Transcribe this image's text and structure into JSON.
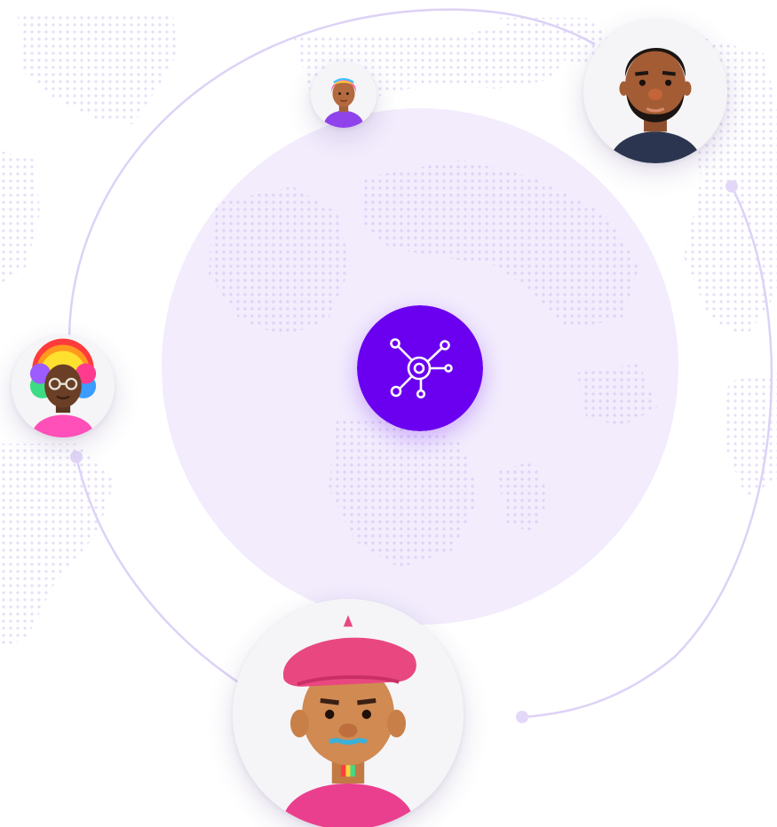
{
  "colors": {
    "accent": "#6b00f0",
    "central_disc": "#f2ecfd",
    "orbit_line": "#ddd2f6",
    "world_map_dots": "#e6def8"
  },
  "hub": {
    "icon": "network-hub-icon"
  },
  "avatars": [
    {
      "name": "avatar-woman-rainbow-hair-small",
      "icon": "person-avatar-icon"
    },
    {
      "name": "avatar-man-beard",
      "icon": "person-avatar-icon"
    },
    {
      "name": "avatar-rainbow-afro-glasses",
      "icon": "person-avatar-icon"
    },
    {
      "name": "avatar-man-pink-beret",
      "icon": "person-avatar-icon"
    }
  ]
}
